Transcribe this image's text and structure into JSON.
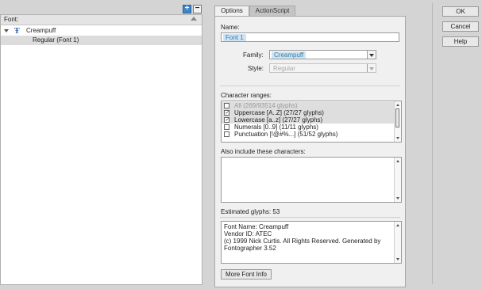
{
  "tree": {
    "header": "Font:",
    "items": [
      {
        "label": "Creampuff"
      },
      {
        "label": "Regular (Font 1)"
      }
    ],
    "add_label": "+",
    "remove_label": "−"
  },
  "tabs": [
    {
      "label": "Options"
    },
    {
      "label": "ActionScript"
    }
  ],
  "options": {
    "name_label": "Name:",
    "name_value": "Font 1",
    "family_label": "Family:",
    "family_value": "Creampuff",
    "style_label": "Style:",
    "style_value": "Regular",
    "ranges_label": "Character ranges:",
    "ranges": [
      {
        "label": "All  (269/93514 glyphs)",
        "checked": false,
        "dim": true
      },
      {
        "label": "Uppercase [A..Z]  (27/27 glyphs)",
        "checked": true
      },
      {
        "label": "Lowercase [a..z]  (27/27 glyphs)",
        "checked": true
      },
      {
        "label": "Numerals [0..9]  (11/11 glyphs)",
        "checked": false
      },
      {
        "label": "Punctuation [!@#%...]  (51/52 glyphs)",
        "checked": false
      }
    ],
    "include_label": "Also include these characters:",
    "include_value": "",
    "estimated_label": "Estimated glyphs: 53",
    "font_info": "Font Name: Creampuff\nVendor ID: ATEC\n(c) 1999 Nick Curtis. All Rights Reserved. Generated by\nFontographer 3.52",
    "more_info_label": "More Font Info"
  },
  "buttons": {
    "ok": "OK",
    "cancel": "Cancel",
    "help": "Help"
  },
  "colors": {
    "accent": "#3f86c8",
    "highlight": "#cfe4f2"
  }
}
